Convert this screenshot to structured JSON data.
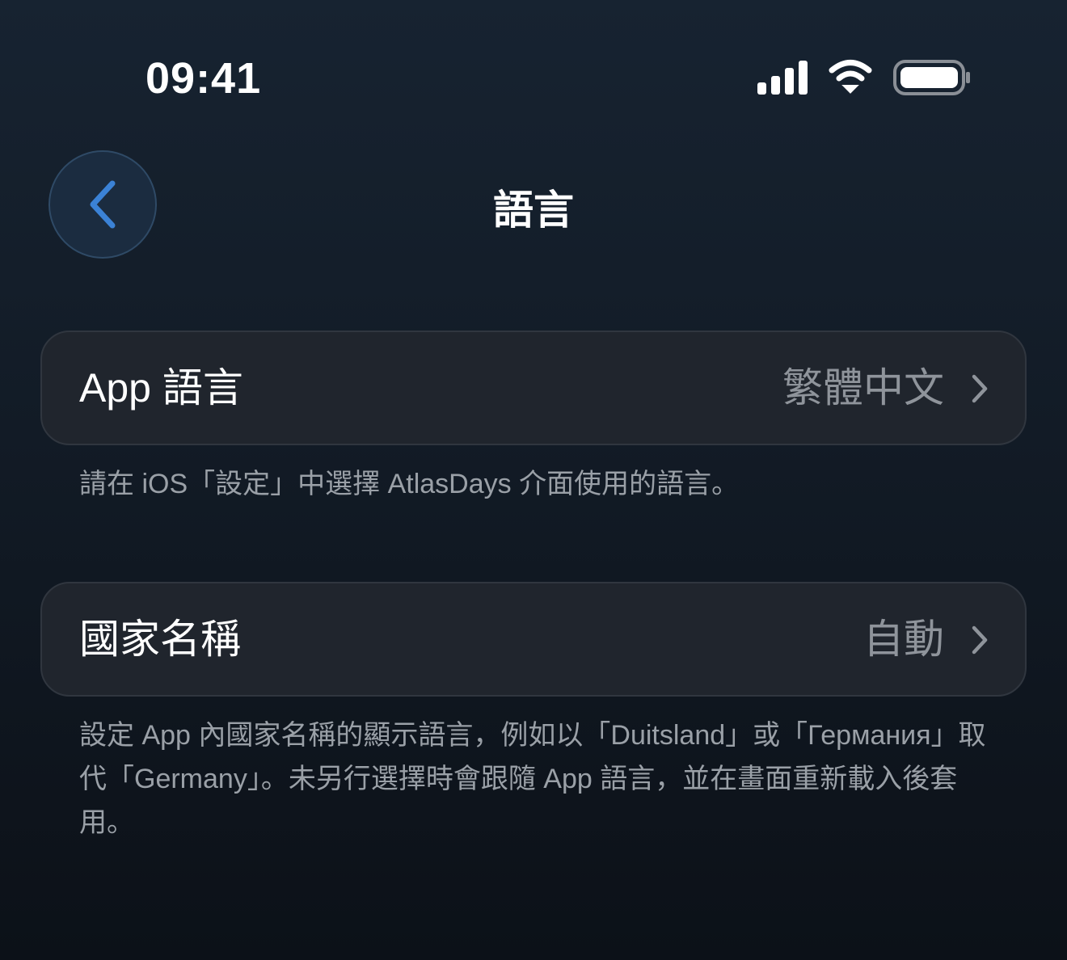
{
  "status_bar": {
    "time": "09:41",
    "icons": [
      "cellular-signal-icon",
      "wifi-icon",
      "battery-icon"
    ]
  },
  "nav": {
    "title": "語言",
    "back_icon": "chevron-left-icon"
  },
  "settings": {
    "app_language": {
      "label": "App 語言",
      "value": "繁體中文",
      "footnote": "請在 iOS「設定」中選擇 AtlasDays 介面使用的語言。"
    },
    "country_names": {
      "label": "國家名稱",
      "value": "自動",
      "footnote": "設定 App 內國家名稱的顯示語言，例如以「Duitsland」或「Германия」取代「Germany」。未另行選擇時會跟隨 App 語言，並在畫面重新載入後套用。"
    }
  },
  "colors": {
    "accent": "#3b82d6",
    "background": "#141d28",
    "card": "#20252d",
    "secondary_text": "#9aa0a7"
  }
}
